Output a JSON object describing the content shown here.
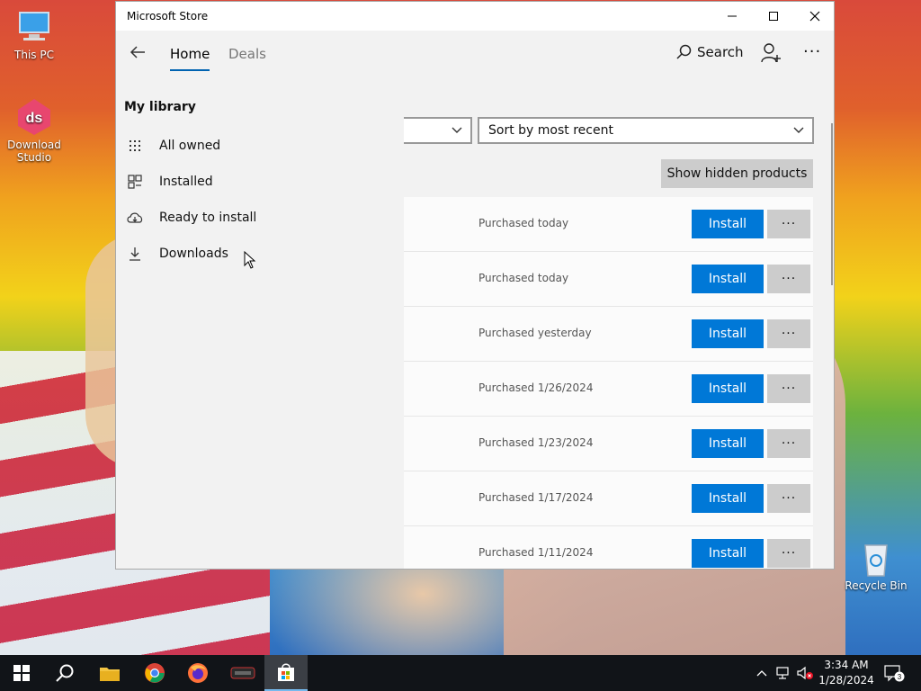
{
  "desktop": {
    "icons": [
      {
        "label": "This PC"
      },
      {
        "label": "Download Studio"
      },
      {
        "label": "Recycle Bin"
      }
    ]
  },
  "window": {
    "title": "Microsoft Store",
    "nav": {
      "tabs": [
        {
          "label": "Home",
          "active": true
        },
        {
          "label": "Deals",
          "active": false
        }
      ],
      "search_label": "Search"
    },
    "library": {
      "heading": "My library",
      "items": [
        {
          "label": "All owned",
          "icon": "grid-dots-icon"
        },
        {
          "label": "Installed",
          "icon": "installed-grid-icon"
        },
        {
          "label": "Ready to install",
          "icon": "cloud-download-icon"
        },
        {
          "label": "Downloads",
          "icon": "download-arrow-icon"
        }
      ]
    },
    "filters": {
      "filter_value": "",
      "sort_value": "Sort by most recent"
    },
    "show_hidden_label": "Show hidden products",
    "products": [
      {
        "purchased": "Purchased today",
        "install_label": "Install",
        "more_label": "···"
      },
      {
        "purchased": "Purchased today",
        "install_label": "Install",
        "more_label": "···"
      },
      {
        "purchased": "Purchased yesterday",
        "install_label": "Install",
        "more_label": "···"
      },
      {
        "purchased": "Purchased 1/26/2024",
        "install_label": "Install",
        "more_label": "···"
      },
      {
        "purchased": "Purchased 1/23/2024",
        "install_label": "Install",
        "more_label": "···"
      },
      {
        "purchased": "Purchased 1/17/2024",
        "install_label": "Install",
        "more_label": "···"
      },
      {
        "purchased": "Purchased 1/11/2024",
        "install_label": "Install",
        "more_label": "···"
      }
    ]
  },
  "taskbar": {
    "time": "3:34 AM",
    "date": "1/28/2024",
    "notification_count": "3"
  },
  "colors": {
    "accent": "#0078d7",
    "tab_underline": "#0063b1"
  }
}
